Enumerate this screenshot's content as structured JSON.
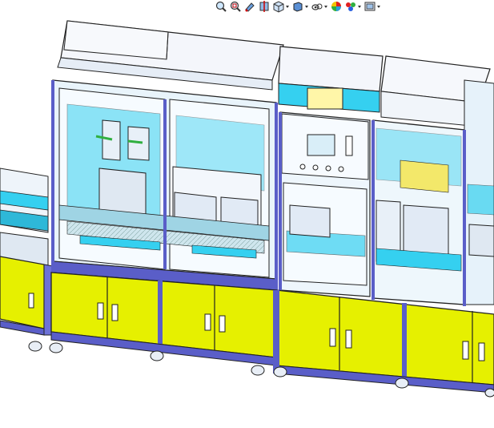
{
  "toolbar": {
    "buttons": [
      {
        "icon": "zoom-to-fit-icon",
        "has_dropdown": false
      },
      {
        "icon": "zoom-to-area-icon",
        "has_dropdown": false
      },
      {
        "icon": "previous-view-icon",
        "has_dropdown": false
      },
      {
        "icon": "section-view-icon",
        "has_dropdown": false
      },
      {
        "icon": "view-orientation-icon",
        "has_dropdown": true
      },
      {
        "icon": "display-style-icon",
        "has_dropdown": true
      },
      {
        "icon": "hide-show-items-icon",
        "has_dropdown": true
      },
      {
        "icon": "edit-appearance-icon",
        "has_dropdown": false
      },
      {
        "icon": "apply-scene-icon",
        "has_dropdown": true
      },
      {
        "icon": "view-settings-icon",
        "has_dropdown": true
      }
    ]
  },
  "model": {
    "description_colors": {
      "base_cabinet": "#e6f000",
      "frame": "#5a5ec8",
      "panel": "#35d0f0",
      "housing": "#f2f5fb",
      "line": "#222222"
    }
  }
}
